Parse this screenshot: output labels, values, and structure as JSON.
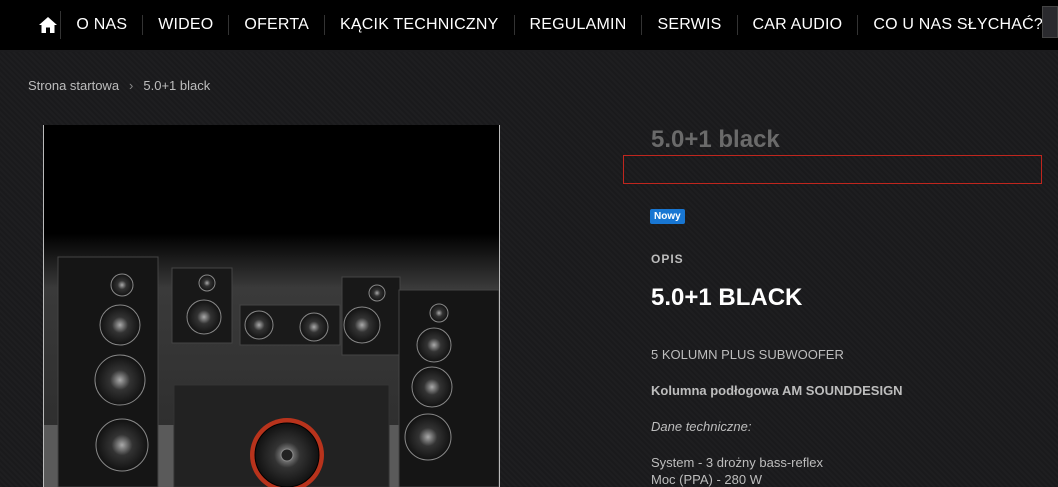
{
  "nav": {
    "items": [
      "O NAS",
      "WIDEO",
      "OFERTA",
      "KĄCIK TECHNICZNY",
      "REGULAMIN",
      "SERWIS",
      "CAR AUDIO",
      "CO U NAS SŁYCHAĆ?"
    ]
  },
  "breadcrumb": {
    "home": "Strona startowa",
    "current": "5.0+1 black"
  },
  "product": {
    "title": "5.0+1 black",
    "badge": "Nowy",
    "section_label": "OPIS",
    "heading": "5.0+1 BLACK",
    "subtitle": "5 KOLUMN PLUS SUBWOOFER",
    "column_title": "Kolumna podłogowa AM SOUNDDESIGN",
    "spec_title": "Dane techniczne:",
    "spec_system": "System - 3 drożny bass-reflex",
    "spec_power": "Moc (PPA) - 280 W"
  },
  "colors": {
    "accent_red": "#c0261e",
    "badge_blue": "#1876d2"
  }
}
